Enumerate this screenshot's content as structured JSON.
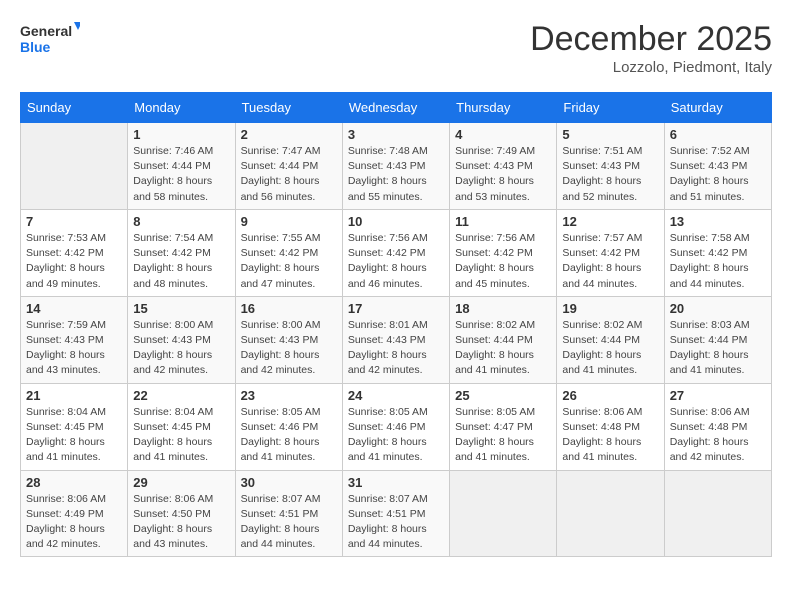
{
  "header": {
    "logo_line1": "General",
    "logo_line2": "Blue",
    "month": "December 2025",
    "location": "Lozzolo, Piedmont, Italy"
  },
  "weekdays": [
    "Sunday",
    "Monday",
    "Tuesday",
    "Wednesday",
    "Thursday",
    "Friday",
    "Saturday"
  ],
  "weeks": [
    [
      {
        "day": "",
        "sunrise": "",
        "sunset": "",
        "daylight": ""
      },
      {
        "day": "1",
        "sunrise": "Sunrise: 7:46 AM",
        "sunset": "Sunset: 4:44 PM",
        "daylight": "Daylight: 8 hours and 58 minutes."
      },
      {
        "day": "2",
        "sunrise": "Sunrise: 7:47 AM",
        "sunset": "Sunset: 4:44 PM",
        "daylight": "Daylight: 8 hours and 56 minutes."
      },
      {
        "day": "3",
        "sunrise": "Sunrise: 7:48 AM",
        "sunset": "Sunset: 4:43 PM",
        "daylight": "Daylight: 8 hours and 55 minutes."
      },
      {
        "day": "4",
        "sunrise": "Sunrise: 7:49 AM",
        "sunset": "Sunset: 4:43 PM",
        "daylight": "Daylight: 8 hours and 53 minutes."
      },
      {
        "day": "5",
        "sunrise": "Sunrise: 7:51 AM",
        "sunset": "Sunset: 4:43 PM",
        "daylight": "Daylight: 8 hours and 52 minutes."
      },
      {
        "day": "6",
        "sunrise": "Sunrise: 7:52 AM",
        "sunset": "Sunset: 4:43 PM",
        "daylight": "Daylight: 8 hours and 51 minutes."
      }
    ],
    [
      {
        "day": "7",
        "sunrise": "Sunrise: 7:53 AM",
        "sunset": "Sunset: 4:42 PM",
        "daylight": "Daylight: 8 hours and 49 minutes."
      },
      {
        "day": "8",
        "sunrise": "Sunrise: 7:54 AM",
        "sunset": "Sunset: 4:42 PM",
        "daylight": "Daylight: 8 hours and 48 minutes."
      },
      {
        "day": "9",
        "sunrise": "Sunrise: 7:55 AM",
        "sunset": "Sunset: 4:42 PM",
        "daylight": "Daylight: 8 hours and 47 minutes."
      },
      {
        "day": "10",
        "sunrise": "Sunrise: 7:56 AM",
        "sunset": "Sunset: 4:42 PM",
        "daylight": "Daylight: 8 hours and 46 minutes."
      },
      {
        "day": "11",
        "sunrise": "Sunrise: 7:56 AM",
        "sunset": "Sunset: 4:42 PM",
        "daylight": "Daylight: 8 hours and 45 minutes."
      },
      {
        "day": "12",
        "sunrise": "Sunrise: 7:57 AM",
        "sunset": "Sunset: 4:42 PM",
        "daylight": "Daylight: 8 hours and 44 minutes."
      },
      {
        "day": "13",
        "sunrise": "Sunrise: 7:58 AM",
        "sunset": "Sunset: 4:42 PM",
        "daylight": "Daylight: 8 hours and 44 minutes."
      }
    ],
    [
      {
        "day": "14",
        "sunrise": "Sunrise: 7:59 AM",
        "sunset": "Sunset: 4:43 PM",
        "daylight": "Daylight: 8 hours and 43 minutes."
      },
      {
        "day": "15",
        "sunrise": "Sunrise: 8:00 AM",
        "sunset": "Sunset: 4:43 PM",
        "daylight": "Daylight: 8 hours and 42 minutes."
      },
      {
        "day": "16",
        "sunrise": "Sunrise: 8:00 AM",
        "sunset": "Sunset: 4:43 PM",
        "daylight": "Daylight: 8 hours and 42 minutes."
      },
      {
        "day": "17",
        "sunrise": "Sunrise: 8:01 AM",
        "sunset": "Sunset: 4:43 PM",
        "daylight": "Daylight: 8 hours and 42 minutes."
      },
      {
        "day": "18",
        "sunrise": "Sunrise: 8:02 AM",
        "sunset": "Sunset: 4:44 PM",
        "daylight": "Daylight: 8 hours and 41 minutes."
      },
      {
        "day": "19",
        "sunrise": "Sunrise: 8:02 AM",
        "sunset": "Sunset: 4:44 PM",
        "daylight": "Daylight: 8 hours and 41 minutes."
      },
      {
        "day": "20",
        "sunrise": "Sunrise: 8:03 AM",
        "sunset": "Sunset: 4:44 PM",
        "daylight": "Daylight: 8 hours and 41 minutes."
      }
    ],
    [
      {
        "day": "21",
        "sunrise": "Sunrise: 8:04 AM",
        "sunset": "Sunset: 4:45 PM",
        "daylight": "Daylight: 8 hours and 41 minutes."
      },
      {
        "day": "22",
        "sunrise": "Sunrise: 8:04 AM",
        "sunset": "Sunset: 4:45 PM",
        "daylight": "Daylight: 8 hours and 41 minutes."
      },
      {
        "day": "23",
        "sunrise": "Sunrise: 8:05 AM",
        "sunset": "Sunset: 4:46 PM",
        "daylight": "Daylight: 8 hours and 41 minutes."
      },
      {
        "day": "24",
        "sunrise": "Sunrise: 8:05 AM",
        "sunset": "Sunset: 4:46 PM",
        "daylight": "Daylight: 8 hours and 41 minutes."
      },
      {
        "day": "25",
        "sunrise": "Sunrise: 8:05 AM",
        "sunset": "Sunset: 4:47 PM",
        "daylight": "Daylight: 8 hours and 41 minutes."
      },
      {
        "day": "26",
        "sunrise": "Sunrise: 8:06 AM",
        "sunset": "Sunset: 4:48 PM",
        "daylight": "Daylight: 8 hours and 41 minutes."
      },
      {
        "day": "27",
        "sunrise": "Sunrise: 8:06 AM",
        "sunset": "Sunset: 4:48 PM",
        "daylight": "Daylight: 8 hours and 42 minutes."
      }
    ],
    [
      {
        "day": "28",
        "sunrise": "Sunrise: 8:06 AM",
        "sunset": "Sunset: 4:49 PM",
        "daylight": "Daylight: 8 hours and 42 minutes."
      },
      {
        "day": "29",
        "sunrise": "Sunrise: 8:06 AM",
        "sunset": "Sunset: 4:50 PM",
        "daylight": "Daylight: 8 hours and 43 minutes."
      },
      {
        "day": "30",
        "sunrise": "Sunrise: 8:07 AM",
        "sunset": "Sunset: 4:51 PM",
        "daylight": "Daylight: 8 hours and 44 minutes."
      },
      {
        "day": "31",
        "sunrise": "Sunrise: 8:07 AM",
        "sunset": "Sunset: 4:51 PM",
        "daylight": "Daylight: 8 hours and 44 minutes."
      },
      {
        "day": "",
        "sunrise": "",
        "sunset": "",
        "daylight": ""
      },
      {
        "day": "",
        "sunrise": "",
        "sunset": "",
        "daylight": ""
      },
      {
        "day": "",
        "sunrise": "",
        "sunset": "",
        "daylight": ""
      }
    ]
  ]
}
